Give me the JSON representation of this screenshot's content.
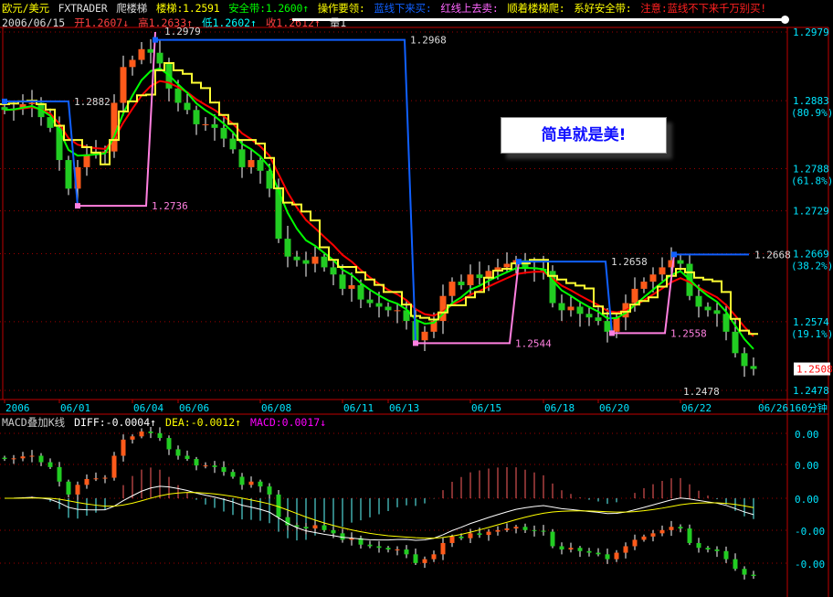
{
  "header": {
    "symbol": "欧元/美元",
    "app": "FXTRADER",
    "indicator": "爬楼梯",
    "ladder": "楼梯:1.2591",
    "safety": "安全带:1.2600↑",
    "tips_title": "操作要领:",
    "tip_blue": "蓝线下来买:",
    "tip_red": "红线上去卖:",
    "tip_climb": "顺着楼梯爬:",
    "tip_belt": "系好安全带:",
    "warning": "注意:蓝线不下来千万别买!"
  },
  "quote": {
    "date": "2006/06/15",
    "open": "开1.2607↓",
    "high": "高1.2633↑",
    "low": "低1.2602↑",
    "close": "收1.2612↑",
    "volume": "量1"
  },
  "callout": "简单就是美!",
  "period": "160分钟",
  "macd_header": {
    "title": "MACD叠加K线",
    "diff": "DIFF:-0.0004↑",
    "dea": "DEA:-0.0012↑",
    "macd": "MACD:0.0017↓"
  },
  "colors": {
    "up": "#ff5a1a",
    "down": "#22cc22",
    "axis": "#c00000",
    "ladder_blue": "#1060ff",
    "ladder_pink": "#ff80e0"
  },
  "chart_data": {
    "type": "candlestick",
    "x_labels": [
      {
        "i": 0,
        "t": "2006"
      },
      {
        "i": 6,
        "t": "06/01"
      },
      {
        "i": 14,
        "t": "06/04"
      },
      {
        "i": 19,
        "t": "06/06"
      },
      {
        "i": 28,
        "t": "06/08"
      },
      {
        "i": 37,
        "t": "06/11"
      },
      {
        "i": 42,
        "t": "06/13"
      },
      {
        "i": 51,
        "t": "06/15"
      },
      {
        "i": 59,
        "t": "06/18"
      },
      {
        "i": 65,
        "t": "06/20"
      },
      {
        "i": 74,
        "t": "06/22"
      },
      {
        "i": 83,
        "t": "06/26"
      }
    ],
    "ylim": [
      1.2478,
      1.2979
    ],
    "y_ticks": [
      {
        "v": 1.2979,
        "t": "1.2979"
      },
      {
        "v": 1.2883,
        "t": "1.2883",
        "p": "(80.9%)"
      },
      {
        "v": 1.2788,
        "t": "1.2788",
        "p": "(61.8%)"
      },
      {
        "v": 1.2729,
        "t": "1.2729"
      },
      {
        "v": 1.2669,
        "t": "1.2669",
        "p": "(38.2%)"
      },
      {
        "v": 1.2574,
        "t": "1.2574",
        "p": "(19.1%)"
      },
      {
        "v": 1.2478,
        "t": "1.2478"
      }
    ],
    "last_price": "1.2508",
    "closes": [
      1.287,
      1.2872,
      1.2878,
      1.288,
      1.286,
      1.2845,
      1.28,
      1.276,
      1.279,
      1.2808,
      1.281,
      1.2812,
      1.288,
      1.293,
      1.294,
      1.2955,
      1.295,
      1.2935,
      1.29,
      1.288,
      1.287,
      1.285,
      1.285,
      1.2845,
      1.283,
      1.2815,
      1.279,
      1.28,
      1.2785,
      1.276,
      1.269,
      1.2665,
      1.266,
      1.2655,
      1.2665,
      1.265,
      1.264,
      1.262,
      1.2625,
      1.2605,
      1.26,
      1.2595,
      1.259,
      1.259,
      1.2575,
      1.2548,
      1.256,
      1.2575,
      1.261,
      1.263,
      1.2625,
      1.264,
      1.2635,
      1.2645,
      1.265,
      1.2655,
      1.266,
      1.265,
      1.2648,
      1.2645,
      1.26,
      1.259,
      1.2595,
      1.2585,
      1.258,
      1.2575,
      1.256,
      1.258,
      1.26,
      1.262,
      1.263,
      1.264,
      1.265,
      1.266,
      1.2655,
      1.261,
      1.2595,
      1.259,
      1.2585,
      1.256,
      1.253,
      1.2512,
      1.2508
    ],
    "ladder_lines": [
      {
        "color": "blue",
        "pts": [
          [
            0,
            1.2882
          ],
          [
            7,
            1.2882
          ],
          [
            8,
            1.2736
          ]
        ],
        "label": "1.2882",
        "li": 7
      },
      {
        "color": "pink",
        "pts": [
          [
            8,
            1.2736
          ],
          [
            15.5,
            1.2736
          ],
          [
            16.5,
            1.2979
          ]
        ],
        "label": "1.2736",
        "li": 15.5
      },
      {
        "color": "blue",
        "pts": [
          [
            16.5,
            1.2968
          ],
          [
            43.8,
            1.2968
          ],
          [
            45,
            1.2544
          ]
        ],
        "label": "1.2968",
        "li": 43.8
      },
      {
        "color": "pink",
        "pts": [
          [
            45,
            1.2544
          ],
          [
            55.3,
            1.2544
          ],
          [
            56.3,
            1.2658
          ]
        ],
        "label": "1.2544",
        "li": 55.3
      },
      {
        "color": "blue",
        "pts": [
          [
            56.3,
            1.2658
          ],
          [
            65.8,
            1.2658
          ],
          [
            66.5,
            1.2558
          ]
        ],
        "label": "1.2658",
        "li": 65.8
      },
      {
        "color": "pink",
        "pts": [
          [
            66.5,
            1.2558
          ],
          [
            72.3,
            1.2558
          ],
          [
            73.3,
            1.2668
          ]
        ],
        "label": "1.2558",
        "li": 72.3
      },
      {
        "color": "blue",
        "pts": [
          [
            73.3,
            1.2668
          ],
          [
            81.5,
            1.2668
          ]
        ],
        "label": "1.2668",
        "li": 81.5
      }
    ],
    "peak_label": "1.2979",
    "low_label": "1.2478",
    "macd_ticks": [
      "0.00",
      "0.00",
      "0.00",
      "-0.00",
      "-0.00"
    ]
  }
}
